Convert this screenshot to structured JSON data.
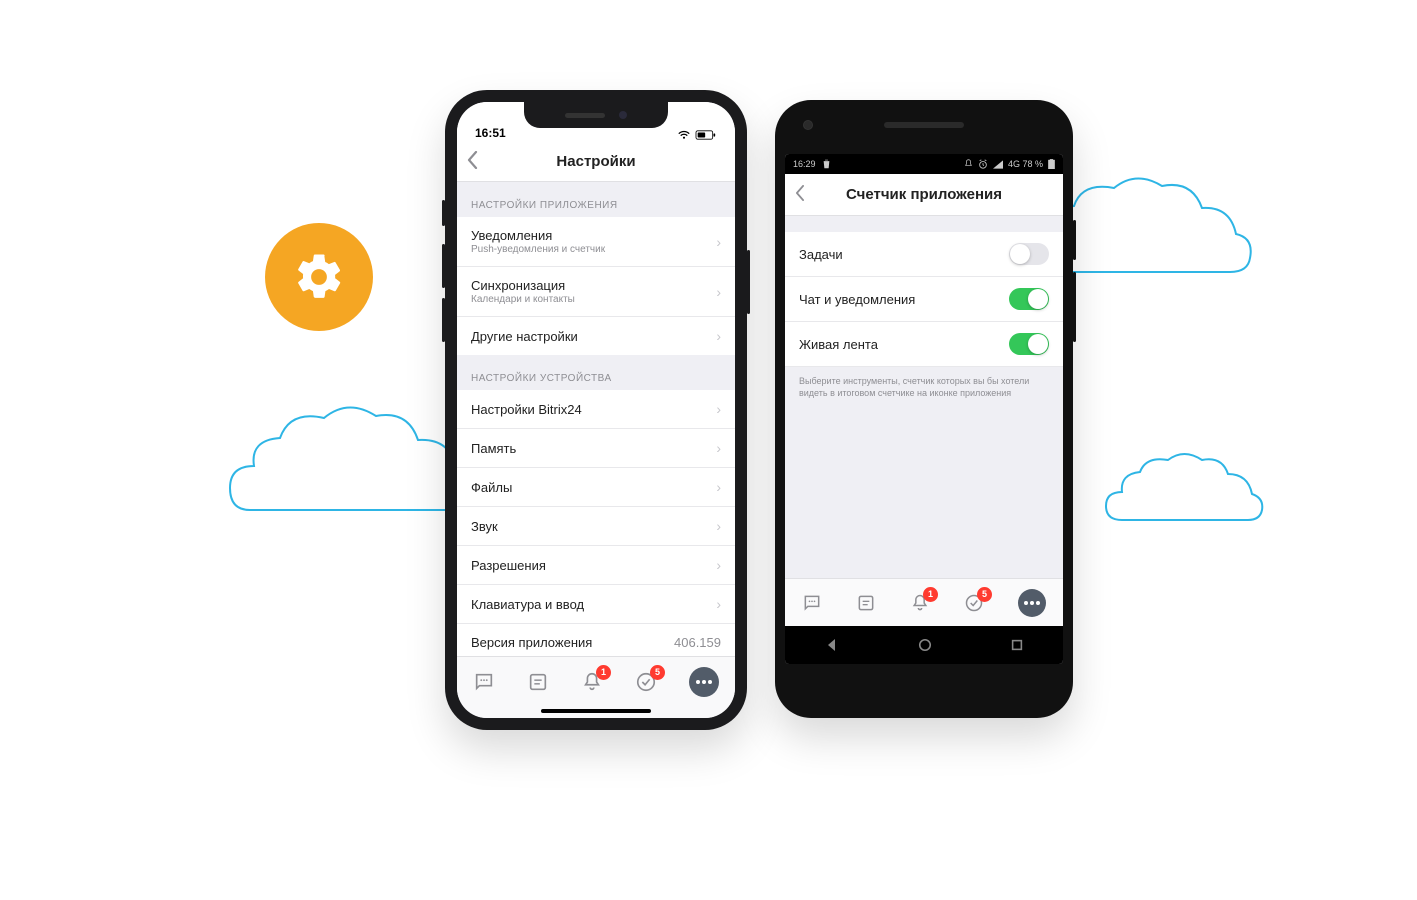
{
  "iphone": {
    "status_time": "16:51",
    "nav_title": "Настройки",
    "sections": {
      "app": {
        "header": "НАСТРОЙКИ ПРИЛОЖЕНИЯ",
        "items": [
          {
            "title": "Уведомления",
            "subtitle": "Push-уведомления и счетчик"
          },
          {
            "title": "Синхронизация",
            "subtitle": "Календари и контакты"
          },
          {
            "title": "Другие настройки"
          }
        ]
      },
      "device": {
        "header": "НАСТРОЙКИ УСТРОЙСТВА",
        "items": [
          {
            "title": "Настройки Bitrix24"
          },
          {
            "title": "Память"
          },
          {
            "title": "Файлы"
          },
          {
            "title": "Звук"
          },
          {
            "title": "Разрешения"
          },
          {
            "title": "Клавиатура и ввод"
          },
          {
            "title": "Версия приложения",
            "value": "406.159"
          }
        ]
      }
    },
    "tabs": {
      "badge_bell": "1",
      "badge_check": "5"
    }
  },
  "android": {
    "status_time": "16:29",
    "status_net": "4G 78 %",
    "nav_title": "Счетчик приложения",
    "items": [
      {
        "label": "Задачи",
        "on": false
      },
      {
        "label": "Чат и уведомления",
        "on": true
      },
      {
        "label": "Живая лента",
        "on": true
      }
    ],
    "helper": "Выберите инструменты, счетчик которых вы бы хотели видеть в итоговом счетчике на иконке приложения",
    "tabs": {
      "badge_bell": "1",
      "badge_check": "5"
    }
  }
}
